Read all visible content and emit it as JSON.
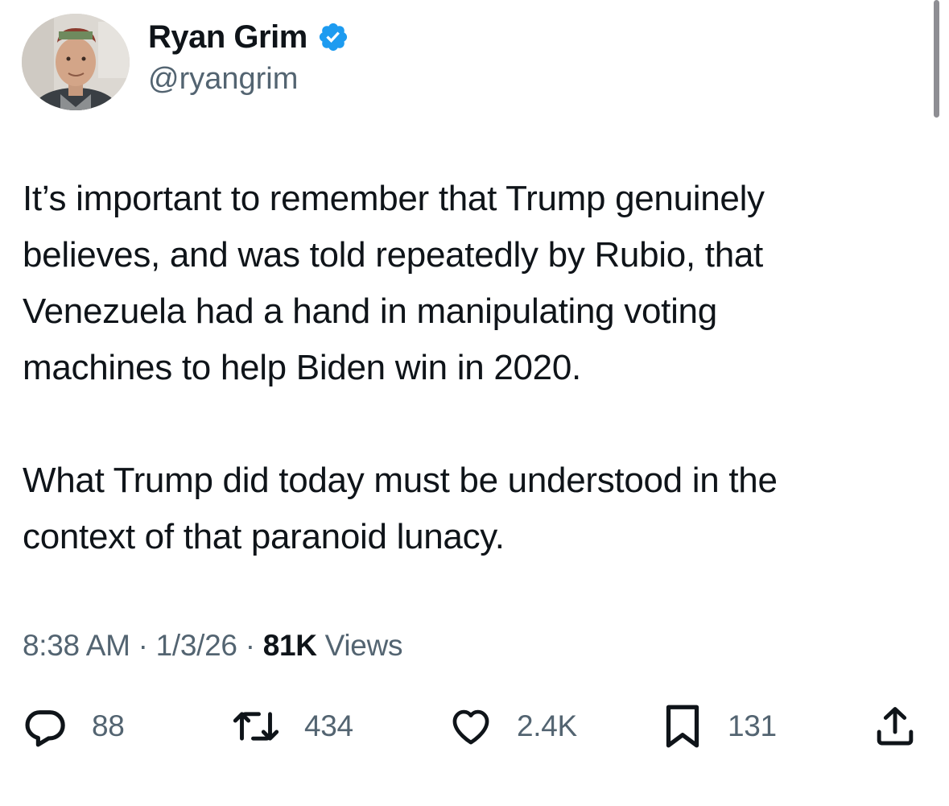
{
  "author": {
    "display_name": "Ryan Grim",
    "handle": "@ryangrim",
    "verified_color": "#1d9bf0",
    "avatar_icon": "profile-photo"
  },
  "tweet": {
    "paragraphs": [
      "It’s important to remember that Trump genuinely\nbelieves, and was told repeatedly by Rubio, that\nVenezuela had a hand in manipulating voting\nmachines to help Biden win in 2020.",
      "What Trump did today must be understood in the\ncontext of that paranoid lunacy."
    ]
  },
  "meta": {
    "time": "8:38 AM",
    "separator": " · ",
    "date": "1/3/26",
    "views_count": "81K",
    "views_label": " Views"
  },
  "actions": {
    "replies": {
      "icon": "reply-icon",
      "count": "88"
    },
    "reposts": {
      "icon": "repost-icon",
      "count": "434"
    },
    "likes": {
      "icon": "heart-icon",
      "count": "2.4K"
    },
    "bookmarks": {
      "icon": "bookmark-icon",
      "count": "131"
    },
    "share": {
      "icon": "share-icon"
    }
  },
  "colors": {
    "text_primary": "#0f1419",
    "text_secondary": "#536471",
    "accent": "#1d9bf0"
  }
}
